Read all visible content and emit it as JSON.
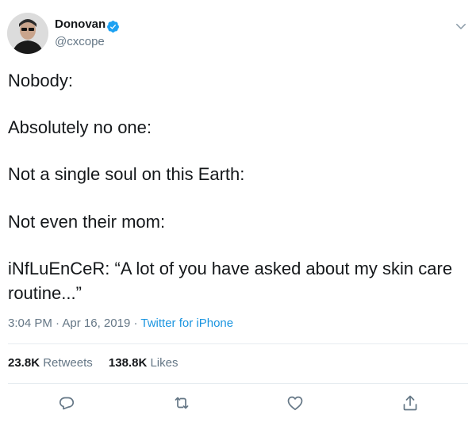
{
  "tweet": {
    "author_name": "Donovan",
    "author_handle": "@cxcope",
    "lines": [
      "Nobody:",
      "Absolutely no one:",
      "Not a single soul on this Earth:",
      "Not even their mom:",
      "iNfLuEnCeR: “A lot of you have asked about my skin care",
      "routine...”"
    ],
    "time": "3:04 PM",
    "separator": "·",
    "date": "Apr 16, 2019",
    "source": "Twitter for iPhone",
    "retweets_count": "23.8K",
    "retweets_label": "Retweets",
    "likes_count": "138.8K",
    "likes_label": "Likes"
  },
  "colors": {
    "accent": "#1da1f2",
    "text": "#14171a",
    "muted": "#657786",
    "divider": "#e6ecf0"
  },
  "icons": {
    "verified": "verified-badge-icon",
    "menu": "chevron-down-icon",
    "reply": "reply-icon",
    "retweet": "retweet-icon",
    "like": "heart-icon",
    "share": "share-icon"
  }
}
